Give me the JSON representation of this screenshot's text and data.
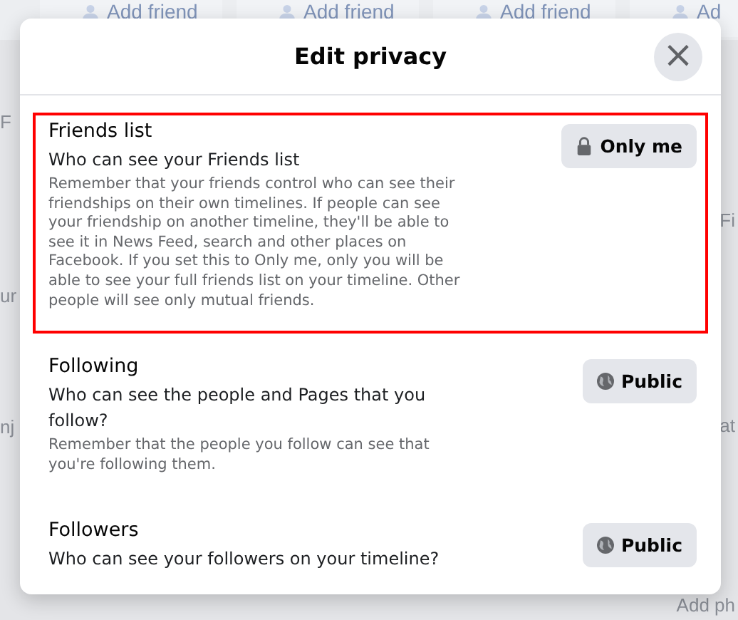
{
  "background": {
    "add_friend_buttons": [
      "Add friend",
      "Add friend",
      "Add friend",
      "Ad"
    ],
    "left_fragments": [
      "F",
      "ur",
      "nj"
    ],
    "right_fragments": [
      "Fi",
      "at",
      "Add ph"
    ]
  },
  "dialog": {
    "title": "Edit privacy",
    "close_label": "×",
    "sections": [
      {
        "title": "Friends list",
        "question": "Who can see your Friends list",
        "note": "Remember that your friends control who can see their friendships on their own timelines. If people can see your friendship on another timeline, they'll be able to see it in News Feed, search and other places on Facebook. If you set this to Only me, only you will be able to see your full friends list on your timeline. Other people will see only mutual friends.",
        "highlighted": true,
        "audience": {
          "kind": "only_me",
          "label": "Only me"
        }
      },
      {
        "title": "Following",
        "question": "Who can see the people and Pages that you follow?",
        "note": "Remember that the people you follow can see that you're following them.",
        "highlighted": false,
        "audience": {
          "kind": "public",
          "label": "Public"
        }
      },
      {
        "title": "Followers",
        "question": "Who can see your followers on your timeline?",
        "highlighted": false,
        "audience": {
          "kind": "public",
          "label": "Public"
        }
      }
    ]
  }
}
